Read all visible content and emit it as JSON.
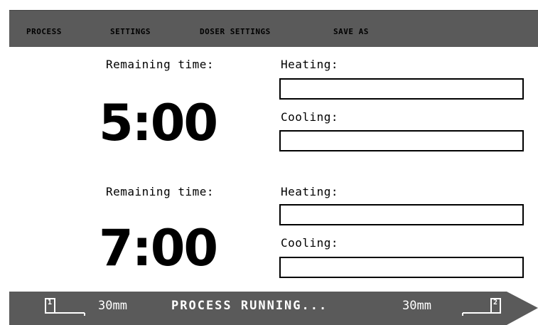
{
  "menu": {
    "items": [
      "PROCESS",
      "SETTINGS",
      "DOSER SETTINGS",
      "SAVE AS"
    ]
  },
  "stations": [
    {
      "remaining_label": "Remaining time:",
      "time": "5:00",
      "heating_label": "Heating:",
      "cooling_label": "Cooling:",
      "heating_progress": 0,
      "cooling_progress": 0
    },
    {
      "remaining_label": "Remaining time:",
      "time": "7:00",
      "heating_label": "Heating:",
      "cooling_label": "Cooling:",
      "heating_progress": 0,
      "cooling_progress": 0
    }
  ],
  "status": {
    "left_station_number": "1",
    "left_size": "30mm",
    "message": "PROCESS RUNNING...",
    "right_size": "30mm",
    "right_station_number": "2"
  },
  "colors": {
    "menu_bg": "#5a5a5a",
    "status_bg": "#5a5a5a",
    "status_text": "#ffffff",
    "foreground": "#000000",
    "background": "#ffffff"
  },
  "icons": {
    "left_station": "station-1-icon",
    "right_station": "station-2-icon"
  }
}
